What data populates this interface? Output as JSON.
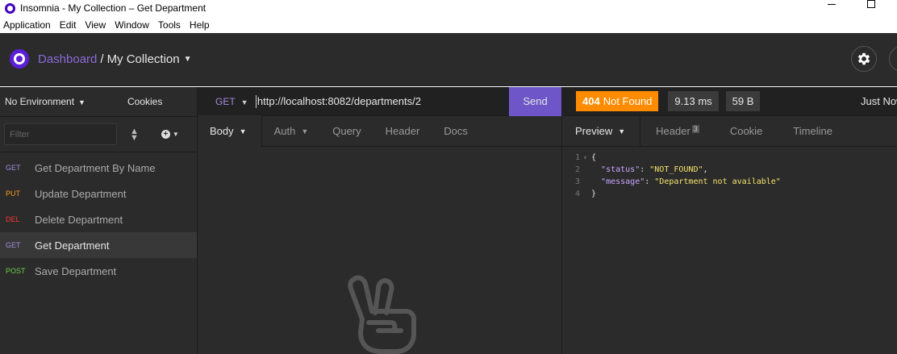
{
  "window": {
    "title": "Insomnia - My Collection – Get Department"
  },
  "menu": [
    "Application",
    "Edit",
    "View",
    "Window",
    "Tools",
    "Help"
  ],
  "header": {
    "dashboard_label": "Dashboard",
    "separator": "/",
    "collection_label": "My Collection",
    "settings_icon": "gear-icon"
  },
  "sidebar": {
    "environment_label": "No Environment",
    "cookies_label": "Cookies",
    "filter_placeholder": "Filter",
    "requests": [
      {
        "method": "GET",
        "name": "Get Department By Name"
      },
      {
        "method": "PUT",
        "name": "Update Department"
      },
      {
        "method": "DEL",
        "name": "Delete Department"
      },
      {
        "method": "GET",
        "name": "Get Department",
        "active": true
      },
      {
        "method": "POST",
        "name": "Save Department"
      }
    ]
  },
  "request": {
    "method": "GET",
    "url": "http://localhost:8082/departments/2",
    "send_label": "Send",
    "tabs": [
      "Body",
      "Auth",
      "Query",
      "Header",
      "Docs"
    ],
    "empty_icon": "peace-hand-icon"
  },
  "response": {
    "status_code": "404",
    "status_text": "Not Found",
    "time": "9.13 ms",
    "size": "59 B",
    "timestamp": "Just Now",
    "tabs": [
      "Preview",
      "Header",
      "Cookie",
      "Timeline"
    ],
    "header_count": "3",
    "lines": [
      {
        "num": "1",
        "text": "{"
      },
      {
        "num": "2",
        "key": "\"status\"",
        "value": "\"NOT_FOUND\"",
        "suffix": ","
      },
      {
        "num": "3",
        "key": "\"message\"",
        "value": "\"Department not available\"",
        "suffix": ""
      },
      {
        "num": "4",
        "text": "}"
      }
    ]
  },
  "colors": {
    "accent": "#6e56c9",
    "status_404": "#ff8c00",
    "get": "#a78bdb",
    "put": "#ff9a1f",
    "delete": "#ff3333",
    "post": "#6ad14a"
  }
}
